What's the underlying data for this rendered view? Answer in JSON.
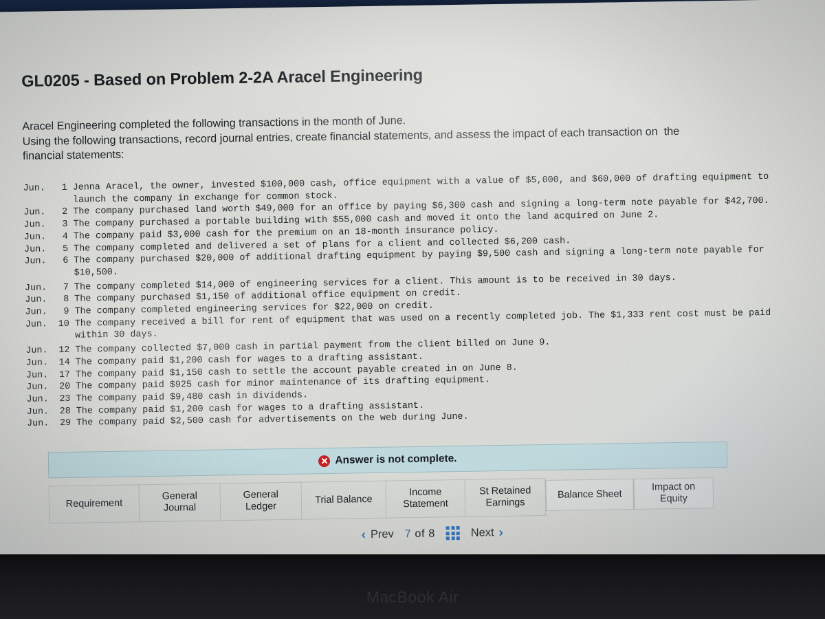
{
  "document": {
    "title": "GL0205 - Based on Problem 2-2A Aracel Engineering",
    "intro_line1": "Aracel Engineering completed the following transactions in the month of June.",
    "intro_line2": "Using the following transactions, record journal entries, create financial statements, and assess the impact of each transaction on  the",
    "intro_line3": "financial statements:"
  },
  "transactions": [
    {
      "month": "Jun.",
      "day": "1",
      "text": "Jenna Aracel, the owner, invested $100,000 cash, office equipment with a value of $5,000, and $60,000 of drafting equipment to launch the company in exchange for common stock."
    },
    {
      "month": "Jun.",
      "day": "2",
      "text": "The company purchased land worth $49,000 for an office by paying $6,300 cash and signing a long-term note payable for $42,700."
    },
    {
      "month": "Jun.",
      "day": "3",
      "text": "The company purchased a portable building with $55,000 cash and moved it onto the land acquired on June 2."
    },
    {
      "month": "Jun.",
      "day": "4",
      "text": "The company paid $3,000 cash for the premium on an 18-month insurance policy."
    },
    {
      "month": "Jun.",
      "day": "5",
      "text": "The company completed and delivered a set of plans for a client and collected $6,200 cash."
    },
    {
      "month": "Jun.",
      "day": "6",
      "text": "The company purchased $20,000 of additional drafting equipment by paying $9,500 cash and signing a long-term note payable for $10,500."
    },
    {
      "month": "Jun.",
      "day": "7",
      "text": "The company completed $14,000 of engineering services for a client. This amount is to be received in 30 days."
    },
    {
      "month": "Jun.",
      "day": "8",
      "text": "The company purchased $1,150 of additional office equipment on credit."
    },
    {
      "month": "Jun.",
      "day": "9",
      "text": "The company completed engineering services for $22,000 on credit."
    },
    {
      "month": "Jun.",
      "day": "10",
      "text": "The company received a bill for rent of equipment that was used on a recently completed job. The $1,333 rent cost must be paid within 30 days."
    },
    {
      "month": "Jun.",
      "day": "12",
      "text": "The company collected $7,000 cash in partial payment from the client billed on June 9."
    },
    {
      "month": "Jun.",
      "day": "14",
      "text": "The company paid $1,200 cash for wages to a drafting assistant."
    },
    {
      "month": "Jun.",
      "day": "17",
      "text": "The company paid $1,150 cash to settle the account payable created in on June 8."
    },
    {
      "month": "Jun.",
      "day": "20",
      "text": "The company paid $925 cash for minor maintenance of its drafting equipment."
    },
    {
      "month": "Jun.",
      "day": "23",
      "text": "The company paid $9,480 cash in dividends."
    },
    {
      "month": "Jun.",
      "day": "28",
      "text": "The company paid $1,200 cash for wages to a drafting assistant."
    },
    {
      "month": "Jun.",
      "day": "29",
      "text": "The company paid $2,500 cash for advertisements on the web during June."
    }
  ],
  "banner": {
    "icon": "error-circle-x-icon",
    "message": "Answer is not complete.",
    "background_color": "#bdd8dc",
    "icon_color": "#c21a1a"
  },
  "tabs": [
    {
      "label": "Requirement",
      "raised": false
    },
    {
      "label": "General\nJournal",
      "raised": false
    },
    {
      "label": "General\nLedger",
      "raised": false
    },
    {
      "label": "Trial Balance",
      "raised": false
    },
    {
      "label": "Income\nStatement",
      "raised": false
    },
    {
      "label": "St Retained\nEarnings",
      "raised": false
    },
    {
      "label": "Balance Sheet",
      "raised": true
    },
    {
      "label": "Impact on\nEquity",
      "raised": true
    }
  ],
  "pagination": {
    "prev_label": "Prev",
    "next_label": "Next",
    "prev_chevron": "‹",
    "next_chevron": "›",
    "current_page": "7",
    "of_word": "of",
    "total_pages": "8",
    "grid_icon": "grid-view-icon",
    "accent_color": "#2f6fbf"
  },
  "device": {
    "brand_label": "MacBook Air"
  }
}
